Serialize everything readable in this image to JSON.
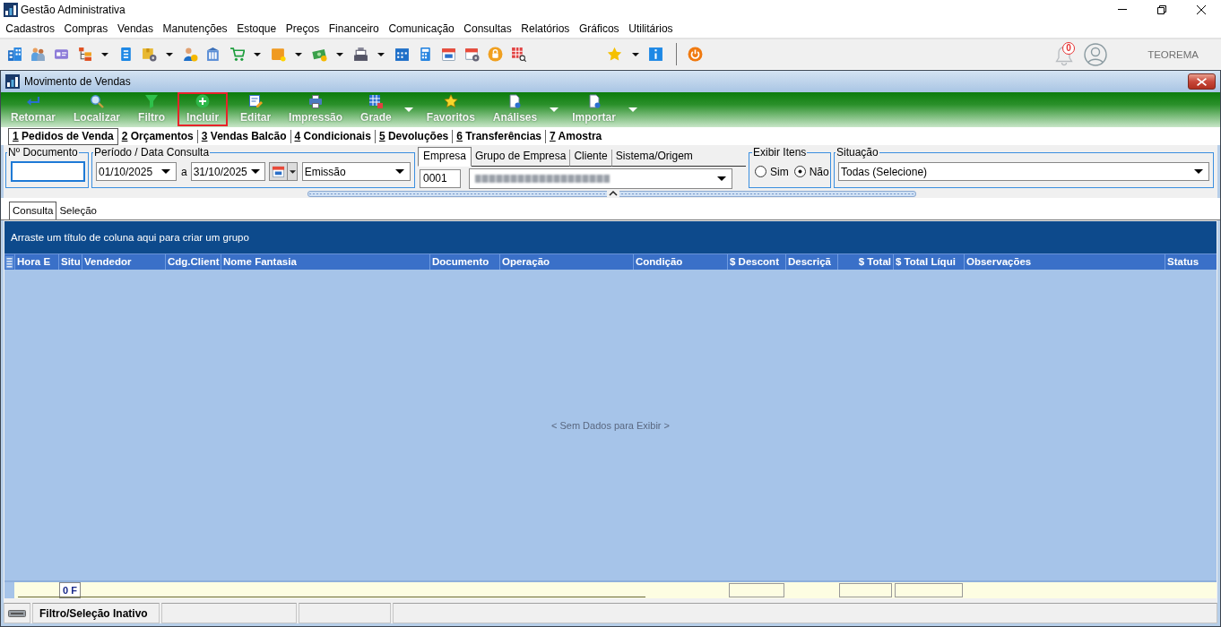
{
  "window": {
    "title": "Gestão Administrativa"
  },
  "menu": [
    "Cadastros",
    "Compras",
    "Vendas",
    "Manutenções",
    "Estoque",
    "Preços",
    "Financeiro",
    "Comunicação",
    "Consultas",
    "Relatórios",
    "Gráficos",
    "Utilitários"
  ],
  "toolbar": {
    "buttons": [
      {
        "dropdown": false
      },
      {
        "dropdown": false
      },
      {
        "dropdown": false
      },
      {
        "dropdown": true
      },
      {
        "dropdown": false
      },
      {
        "dropdown": true
      },
      {
        "dropdown": false
      },
      {
        "dropdown": false
      },
      {
        "dropdown": true
      },
      {
        "dropdown": true
      },
      {
        "dropdown": true
      },
      {
        "dropdown": true
      },
      {
        "dropdown": false
      },
      {
        "dropdown": false
      },
      {
        "dropdown": false
      },
      {
        "dropdown": false
      },
      {
        "dropdown": false
      },
      {
        "dropdown": false
      },
      {
        "dropdown": true
      },
      {
        "dropdown": false
      },
      {
        "dropdown": false
      }
    ],
    "notifications": {
      "count": "0"
    },
    "user": "TEOREMA"
  },
  "child_window": {
    "title": "Movimento de Vendas",
    "actions": [
      {
        "label": "Retornar",
        "dropdown": false,
        "highlighted": false
      },
      {
        "label": "Localizar",
        "dropdown": false,
        "highlighted": false
      },
      {
        "label": "Filtro",
        "dropdown": false,
        "highlighted": false
      },
      {
        "label": "Incluir",
        "dropdown": false,
        "highlighted": true
      },
      {
        "label": "Editar",
        "dropdown": false,
        "highlighted": false
      },
      {
        "label": "Impressão",
        "dropdown": false,
        "highlighted": false
      },
      {
        "label": "Grade",
        "dropdown": true,
        "highlighted": false
      },
      {
        "label": "Favoritos",
        "dropdown": false,
        "highlighted": false
      },
      {
        "label": "Análises",
        "dropdown": true,
        "highlighted": false
      },
      {
        "label": "Importar",
        "dropdown": true,
        "highlighted": false
      }
    ],
    "tabs": [
      {
        "key": "1",
        "label": "Pedidos de Venda",
        "selected": true
      },
      {
        "key": "2",
        "label": "Orçamentos",
        "selected": false
      },
      {
        "key": "3",
        "label": "Vendas Balcão",
        "selected": false
      },
      {
        "key": "4",
        "label": "Condicionais",
        "selected": false
      },
      {
        "key": "5",
        "label": "Devoluções",
        "selected": false
      },
      {
        "key": "6",
        "label": "Transferências",
        "selected": false
      },
      {
        "key": "7",
        "label": "Amostra",
        "selected": false
      }
    ],
    "filters": {
      "document": {
        "label": "Nº Documento"
      },
      "period": {
        "label": "Período / Data Consulta",
        "from": "01/10/2025",
        "separator": "a",
        "to": "31/10/2025",
        "date_field": "Emissão"
      },
      "company": {
        "tabs": [
          {
            "label": "Empresa",
            "selected": true
          },
          {
            "label": "Grupo de Empresa",
            "selected": false
          },
          {
            "label": "Cliente",
            "selected": false
          },
          {
            "label": "Sistema/Origem",
            "selected": false
          }
        ],
        "code": "0001"
      },
      "show_items": {
        "label": "Exibir Itens",
        "options": [
          {
            "label": "Sim",
            "selected": false
          },
          {
            "label": "Não",
            "selected": true
          }
        ]
      },
      "situation": {
        "label": "Situação",
        "value": "Todas (Selecione)"
      }
    },
    "grid": {
      "tabs": [
        {
          "label": "Consulta",
          "selected": true
        },
        {
          "label": "Seleção",
          "selected": false
        }
      ],
      "group_hint": "Arraste um título de coluna aqui para criar um grupo",
      "columns": [
        "Hora E",
        "Situ",
        "Vendedor",
        "Cdg.Client",
        "Nome Fantasia",
        "Documento",
        "Operação",
        "Condição",
        "$ Descont",
        "Descriçã",
        "$ Total",
        "$ Total Líqui",
        "Observações",
        "Status"
      ],
      "empty_message": "< Sem Dados para Exibir >",
      "footer": {
        "count": "0 F"
      }
    },
    "status_bar": {
      "text": "Filtro/Seleção Inativo"
    }
  }
}
